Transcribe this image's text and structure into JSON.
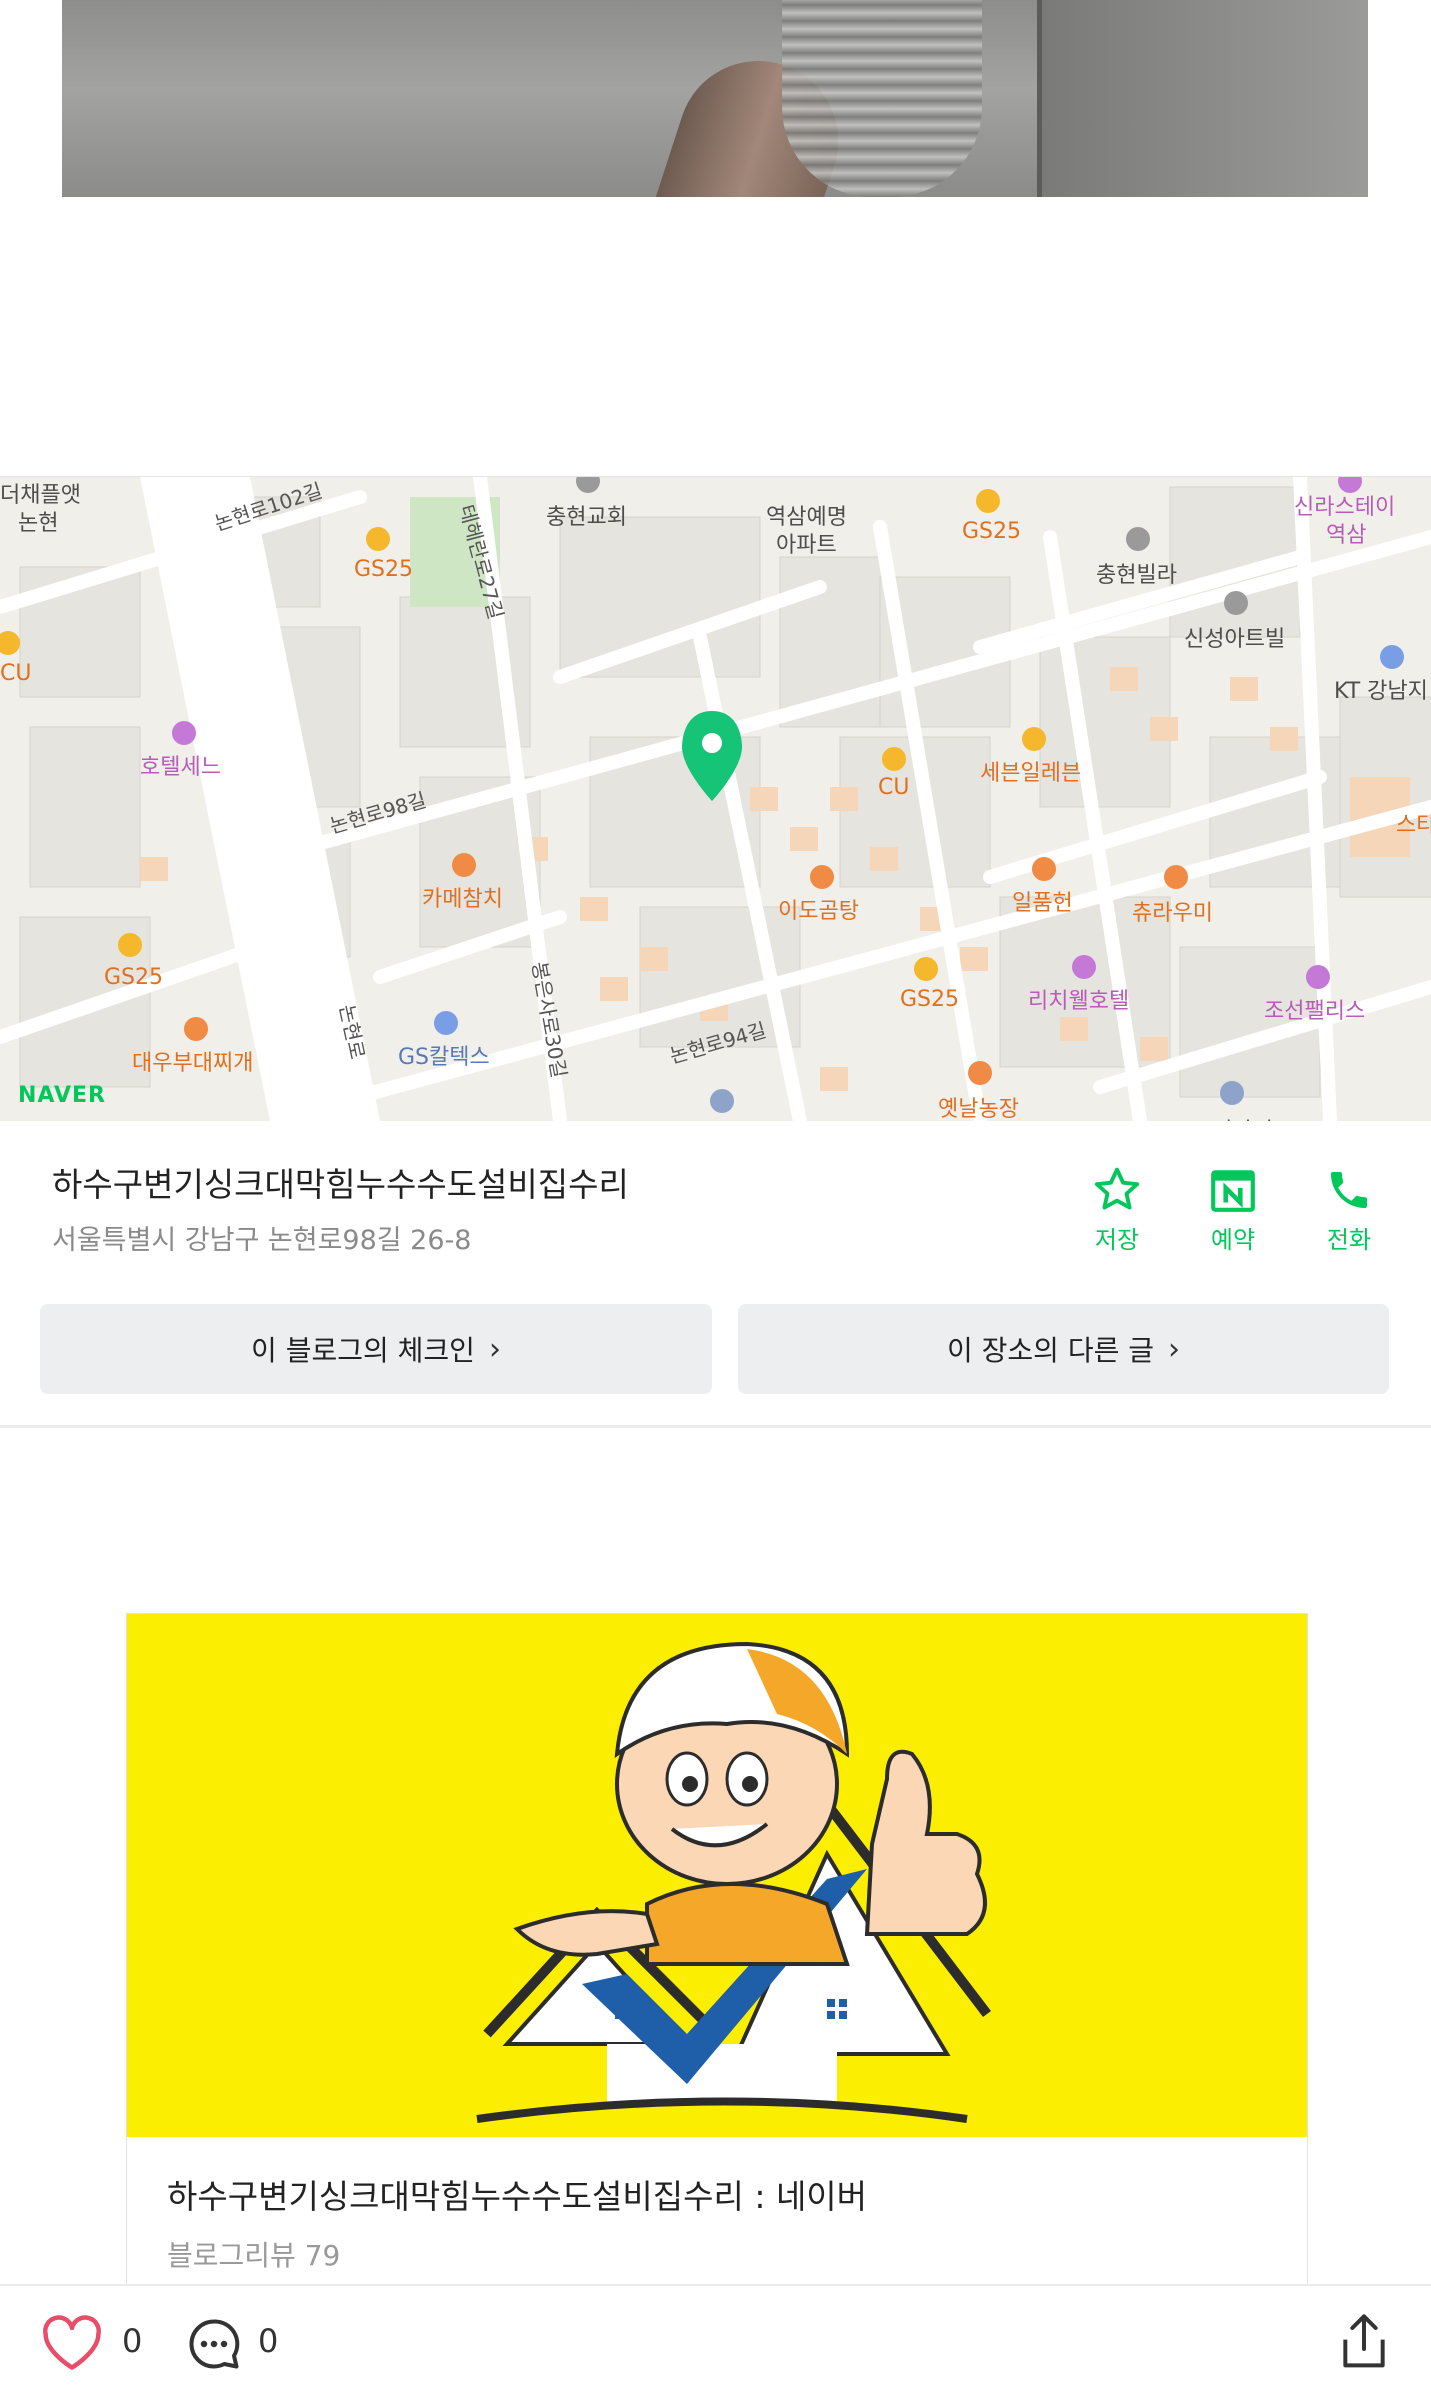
{
  "map": {
    "brand": "NAVER",
    "labels": {
      "l0": "더채플앳",
      "l0b": "논현",
      "l1": "충현교회",
      "l2": "역삼예명",
      "l2b": "아파트",
      "l3": "GS25",
      "l4": "GS25",
      "l5": "충현빌라",
      "l6": "신라스테이",
      "l6b": "역삼",
      "l7": "신성아트빌",
      "l8": "KT 강남지",
      "l9": "CU",
      "l10": "호텔세느",
      "l11": "CU",
      "l12": "세븐일레븐",
      "l13": "카메참치",
      "l14": "이도곰탕",
      "l15": "일품헌",
      "l16": "츄라우미",
      "l17": "스타",
      "l18": "GS25",
      "l19": "GS25",
      "l20": "리치웰호텔",
      "l21": "조선팰리스",
      "l22": "대우부대찌개",
      "l23": "GS칼텍스",
      "l24": "옛날농장",
      "l25": "코리아이"
    },
    "roads": {
      "r1": "논현로102길",
      "r2": "테헤란로27길",
      "r3": "논현로98길",
      "r4": "봉은사로30길",
      "r5": "논현로",
      "r6": "논현로94길"
    }
  },
  "place": {
    "title": "하수구변기싱크대막힘누수수도설비집수리",
    "address": "서울특별시 강남구 논현로98길 26-8",
    "actions": [
      {
        "label": "저장",
        "icon": "star-icon"
      },
      {
        "label": "예약",
        "icon": "calendar-n-icon"
      },
      {
        "label": "전화",
        "icon": "phone-icon"
      }
    ],
    "buttons": {
      "checkin": "이 블로그의 체크인",
      "other_posts": "이 장소의 다른 글"
    }
  },
  "card": {
    "title": "하수구변기싱크대막힘누수수도설비집수리 : 네이버",
    "meta": "블로그리뷰 79"
  },
  "bottom": {
    "like_count": "0",
    "comment_count": "0"
  },
  "colors": {
    "accent": "#03c75a",
    "card_bg": "#fcee00"
  }
}
